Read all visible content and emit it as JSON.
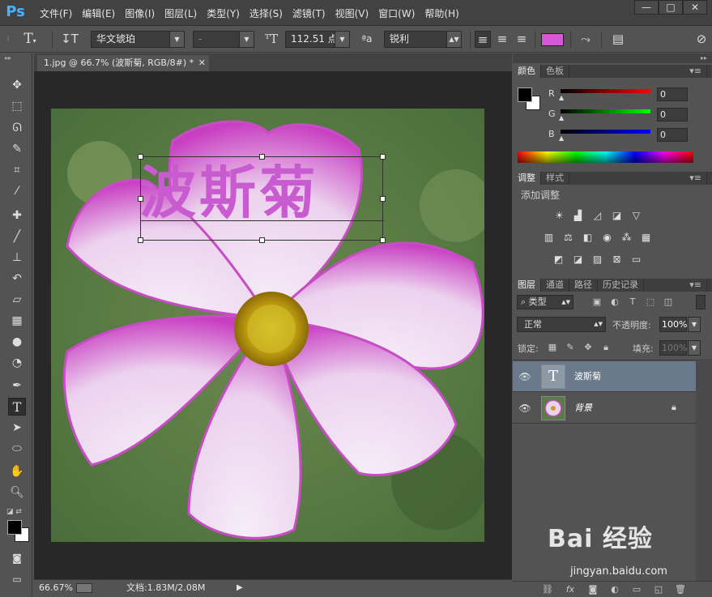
{
  "app": {
    "logo": "Ps"
  },
  "menu": [
    "文件(F)",
    "编辑(E)",
    "图像(I)",
    "图层(L)",
    "类型(Y)",
    "选择(S)",
    "滤镜(T)",
    "视图(V)",
    "窗口(W)",
    "帮助(H)"
  ],
  "window_controls": {
    "minimize": "—",
    "restore": "□",
    "close": "✕"
  },
  "options": {
    "tool_glyph": "T",
    "font_family": "华文琥珀",
    "font_style": "-",
    "font_size": "112.51 点",
    "aa_label": "ªa",
    "antialias": "锐利",
    "text_color": "#d35ad4"
  },
  "document": {
    "tab_title": "1.jpg @ 66.7% (波斯菊, RGB/8#) *",
    "tab_close": "✕",
    "canvas_text": "波斯菊",
    "text_color": "#c95bd0",
    "zoom": "66.67%",
    "doc_info": "文档:1.83M/2.08M"
  },
  "color_panel": {
    "tabs": [
      "颜色",
      "色板"
    ],
    "channels": [
      {
        "label": "R",
        "value": "0"
      },
      {
        "label": "G",
        "value": "0"
      },
      {
        "label": "B",
        "value": "0"
      }
    ],
    "foreground": "#000000",
    "background": "#ffffff"
  },
  "adjust_panel": {
    "tabs": [
      "调整",
      "样式"
    ],
    "title": "添加调整"
  },
  "layers_panel": {
    "tabs": [
      "图层",
      "通道",
      "路径",
      "历史记录"
    ],
    "filter": "类型",
    "blend_mode": "正常",
    "opacity_label": "不透明度:",
    "opacity": "100%",
    "lock_label": "锁定:",
    "fill_label": "填充:",
    "fill": "100%",
    "layers": [
      {
        "name": "波斯菊",
        "type": "text",
        "selected": true,
        "thumb_glyph": "T"
      },
      {
        "name": "背景",
        "type": "image",
        "selected": false,
        "locked": true
      }
    ]
  },
  "watermark": {
    "text": "Bai 经验",
    "url": "jingyan.baidu.com"
  }
}
